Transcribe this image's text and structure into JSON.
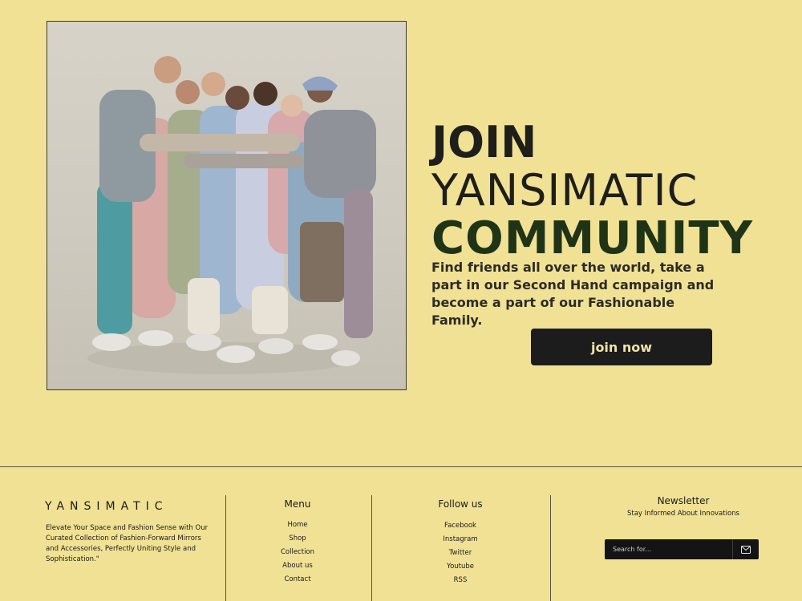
{
  "hero": {
    "headline_line1": "JOIN",
    "headline_line2": "YANSIMATIC",
    "headline_line3": "COMMUNITY",
    "tagline": "Find friends all over the world, take a part in our Second Hand campaign and become a part of our Fashionable Family.",
    "cta_label": "join now"
  },
  "footer": {
    "brand": "YANSIMATIC",
    "description": "Elevate Your Space and Fashion Sense with Our Curated Collection of Fashion-Forward Mirrors and Accessories, Perfectly Uniting Style and Sophistication.\"",
    "menu": {
      "title": "Menu",
      "items": [
        "Home",
        "Shop",
        "Collection",
        "About us",
        "Contact"
      ]
    },
    "follow": {
      "title": "Follow us",
      "items": [
        "Facebook",
        "Instagram",
        "Twitter",
        "Youtube",
        "RSS"
      ]
    },
    "newsletter": {
      "title": "Newsletter",
      "subtitle": "Stay Informed About Innovations",
      "search_placeholder": "Search for..."
    }
  },
  "icons": {
    "submit": "mail-icon"
  },
  "colors": {
    "background": "#f1e194",
    "accent_green": "#1f3316",
    "button_dark": "#1c1c1c"
  }
}
